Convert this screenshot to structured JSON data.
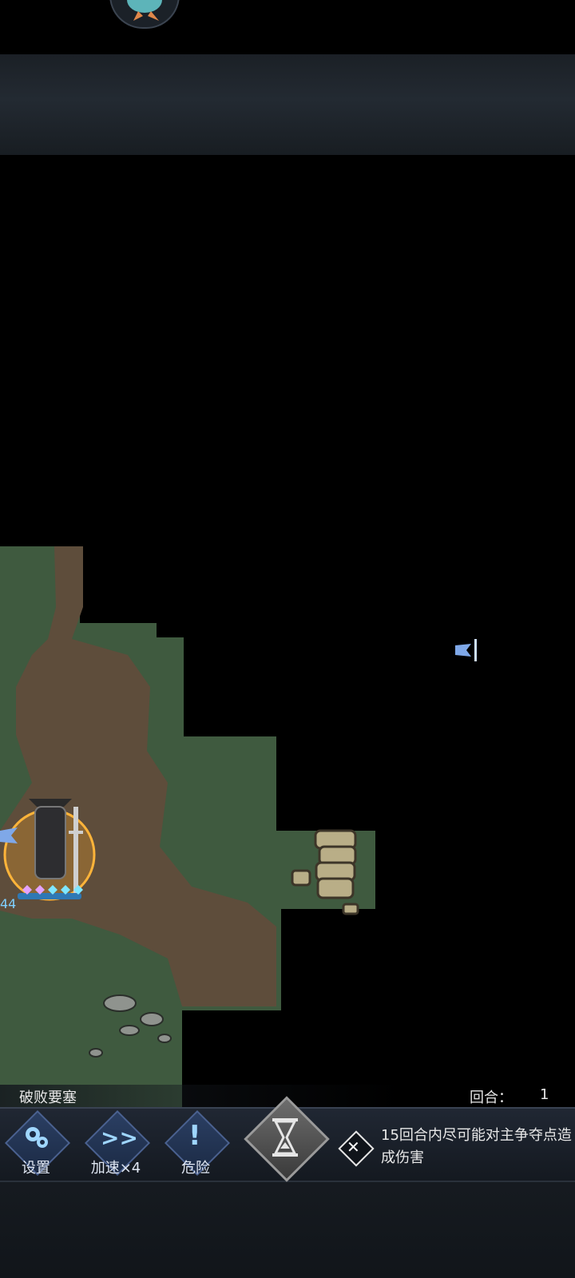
{
  "map": {
    "stage_name": "破败要塞",
    "round_label": "回合：",
    "round_value": "1",
    "unit_level": "44"
  },
  "hud": {
    "settings_label": "设置",
    "speed_label": "加速×4",
    "danger_label": "危险",
    "objective_text": "15回合内尽可能对主争夺点造成伤害"
  },
  "colors": {
    "grass": "#3f5a3f",
    "dirt": "#5a4a3a",
    "fog": "#000000",
    "button_blue": "#2b3f63",
    "flag_blue": "#7fa8e8"
  }
}
